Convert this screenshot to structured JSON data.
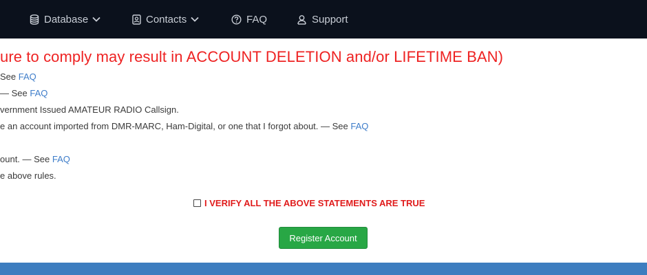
{
  "nav": {
    "database_label": "Database",
    "contacts_label": "Contacts",
    "faq_label": "FAQ",
    "support_label": "Support"
  },
  "warning_text": "ure to comply may result in ACCOUNT DELETION and/or LIFETIME BAN)",
  "rules": [
    {
      "text": "See ",
      "link": "FAQ"
    },
    {
      "text": "— See ",
      "link": "FAQ"
    },
    {
      "text": "vernment Issued AMATEUR RADIO Callsign.",
      "link": ""
    },
    {
      "text": "e an account imported from DMR-MARC, Ham-Digital, or one that I forgot about. — See ",
      "link": "FAQ"
    },
    {
      "text": "ount. — See ",
      "link": "FAQ"
    },
    {
      "text": "e above rules.",
      "link": ""
    }
  ],
  "verify_text": "I VERIFY ALL THE ABOVE STATEMENTS ARE TRUE",
  "verify_checked": false,
  "register_label": "Register Account",
  "colors": {
    "navbar_bg": "#0b111c",
    "warning_red": "#ee2222",
    "link_blue": "#3d7cc9",
    "button_green": "#28a745",
    "footer_blue": "#3d7dbf"
  },
  "icons": [
    "database-icon",
    "chevron-down-icon",
    "contacts-icon",
    "faq-icon",
    "support-icon"
  ]
}
